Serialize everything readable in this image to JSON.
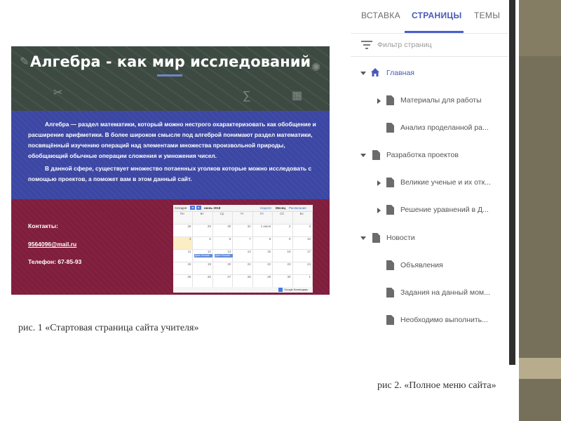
{
  "figure1": {
    "caption": "рис. 1 «Стартовая страница сайта учителя»",
    "site_title": "Алгебра - как мир исследований",
    "intro_paragraph_1": "Алгебра — раздел математики, который можно нестрого охарактеризовать как обобщение и расширение арифметики. В более широком смысле под алгеброй понимают раздел математики, посвящённый изучению операций над элементами множества произвольной природы, обобщающий обычные операции сложения и умножения чисел.",
    "intro_paragraph_2": "В данной сфере, существует множество потаенных уголков которые можно исследовать с помощью проектов, а поможет вам в этом данный сайт.",
    "contacts_title": "Контакты:",
    "email": "9564096@mail.ru",
    "phone": "Телефон: 67-85-93",
    "calendar": {
      "today_button": "Сегодня",
      "month": "июнь 2018",
      "view_week": "Неделя",
      "view_month": "Месяц",
      "view_agenda": "Расписание",
      "weekdays": [
        "Пн",
        "Вт",
        "Ср",
        "Чт",
        "Пт",
        "Сб",
        "Вс"
      ],
      "weeks": [
        [
          "28",
          "29",
          "30",
          "31",
          "1 июня",
          "2",
          "3"
        ],
        [
          "4",
          "5",
          "6",
          "7",
          "8",
          "9",
          "10"
        ],
        [
          "11",
          "12",
          "13",
          "14",
          "15",
          "16",
          "17"
        ],
        [
          "18",
          "19",
          "20",
          "21",
          "22",
          "23",
          "24"
        ],
        [
          "25",
          "26",
          "27",
          "28",
          "29",
          "30",
          "1"
        ]
      ],
      "events": [
        "День Россия",
        "День Россия"
      ],
      "footer_text": "Google Календарь"
    }
  },
  "figure2": {
    "caption": "рис 2. «Полное меню сайта»",
    "tabs": [
      "ВСТАВКА",
      "СТРАНИЦЫ",
      "ТЕМЫ"
    ],
    "active_tab": "СТРАНИЦЫ",
    "filter_placeholder": "Фильтр страниц",
    "pages": [
      {
        "label": "Главная",
        "level": 0,
        "expanded": true,
        "icon": "home-icon",
        "selected": true
      },
      {
        "label": "Материалы для работы",
        "level": 1,
        "expanded": false,
        "icon": "page-icon"
      },
      {
        "label": "Анализ проделанной ра...",
        "level": 1,
        "icon": "page-icon"
      },
      {
        "label": "Разработка проектов",
        "level": 0,
        "expanded": true,
        "icon": "page-icon"
      },
      {
        "label": "Великие ученые и их отк...",
        "level": 1,
        "expanded": false,
        "icon": "page-icon"
      },
      {
        "label": "Решение уравнений в Д...",
        "level": 1,
        "expanded": false,
        "icon": "page-icon"
      },
      {
        "label": "Новости",
        "level": 0,
        "expanded": true,
        "icon": "page-icon"
      },
      {
        "label": "Объявления",
        "level": 1,
        "icon": "page-icon"
      },
      {
        "label": "Задания на данный мом...",
        "level": 1,
        "icon": "page-icon"
      },
      {
        "label": "Необходимо выполнить...",
        "level": 1,
        "icon": "page-icon"
      }
    ]
  },
  "colors": {
    "header_green": "#3d4a42",
    "intro_blue": "#3c47a4",
    "contacts_red": "#801e3d",
    "accent_blue": "#4a5fd1",
    "slide_olive": "#76705a"
  }
}
